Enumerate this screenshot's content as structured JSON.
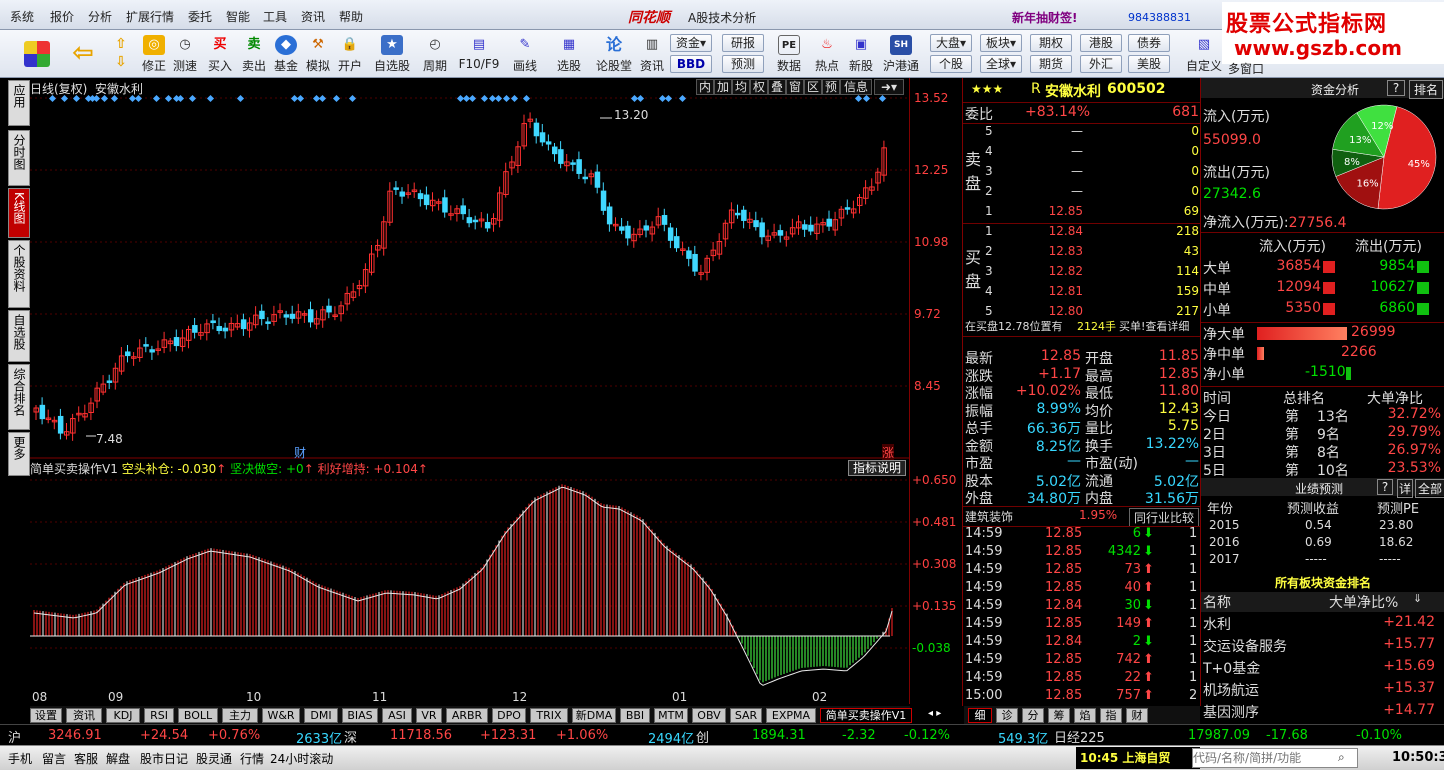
{
  "menu": {
    "items": [
      "系统",
      "报价",
      "分析",
      "扩展行情",
      "委托",
      "智能",
      "工具",
      "资讯",
      "帮助"
    ],
    "brand": "同花顺",
    "title": "A股技术分析",
    "promo": "新年抽财签!",
    "account": "984388831"
  },
  "watermark": {
    "line1": "股票公式指标网",
    "line2": "www.gszb.com"
  },
  "toolbar": {
    "buttons": [
      "修正",
      "测速",
      "买入",
      "卖出",
      "基金",
      "模拟",
      "开户",
      "自选股",
      "周期",
      "F10/F9",
      "画线",
      "选股",
      "论股堂",
      "资讯",
      "数据",
      "热点",
      "新股",
      "沪港通",
      "自定义",
      "多窗口"
    ],
    "small_top": [
      "资金",
      "研报",
      "大盘",
      "板块",
      "期权",
      "港股",
      "债券"
    ],
    "small_bottom": [
      "BBD",
      "预测",
      "个股",
      "全球",
      "期货",
      "外汇",
      "美股"
    ],
    "pe": "PE"
  },
  "sidetabs": [
    "应用",
    "分时图",
    "K线图",
    "个股资料",
    "自选股",
    "综合排名",
    "更多"
  ],
  "chart": {
    "title": "日线(复权)",
    "stock": "安徽水利",
    "tools": [
      "内",
      "加",
      "均",
      "权",
      "叠",
      "窗",
      "区",
      "预",
      "信息"
    ],
    "price_ticks": [
      "13.52",
      "12.25",
      "10.98",
      "9.72",
      "8.45"
    ],
    "high_mark": "13.20",
    "low_mark": "7.48",
    "mark_cai": "财",
    "mark_zhang": "涨",
    "ind_name": "简单买卖操作V1",
    "ind_v1": "空头补仓: -0.030",
    "ind_v2": "坚决做空: +0",
    "ind_v3": "利好增持: +0.104",
    "ind_help": "指标说明",
    "ind_ticks": [
      "+0.650",
      "+0.481",
      "+0.308",
      "+0.135",
      "-0.038"
    ],
    "dates": [
      "08",
      "09",
      "10",
      "11",
      "12",
      "01",
      "02"
    ]
  },
  "bottom_tabs": [
    "设置",
    "资讯",
    "KDJ",
    "RSI",
    "BOLL",
    "主力",
    "W&R",
    "DMI",
    "BIAS",
    "ASI",
    "VR",
    "ARBR",
    "DPO",
    "TRIX",
    "新DMA",
    "BBI",
    "MTM",
    "OBV",
    "SAR",
    "EXPMA",
    "简单买卖操作V1"
  ],
  "right_tabs": [
    "细",
    "诊",
    "分",
    "筹",
    "焰",
    "指",
    "财"
  ],
  "quote": {
    "stars": "★★★",
    "prefix": "R",
    "name": "安徽水利",
    "code": "600502",
    "weibi_label": "委比",
    "weibi": "+83.14%",
    "weicha": "681",
    "sell_label": "卖盘",
    "buy_label": "买盘",
    "sell": [
      {
        "n": "5",
        "p": "—",
        "v": "0"
      },
      {
        "n": "4",
        "p": "—",
        "v": "0"
      },
      {
        "n": "3",
        "p": "—",
        "v": "0"
      },
      {
        "n": "2",
        "p": "—",
        "v": "0"
      },
      {
        "n": "1",
        "p": "12.85",
        "v": "69"
      }
    ],
    "buy": [
      {
        "n": "1",
        "p": "12.84",
        "v": "218"
      },
      {
        "n": "2",
        "p": "12.83",
        "v": "43"
      },
      {
        "n": "3",
        "p": "12.82",
        "v": "114"
      },
      {
        "n": "4",
        "p": "12.81",
        "v": "159"
      },
      {
        "n": "5",
        "p": "12.80",
        "v": "217"
      }
    ],
    "notice": "在买盘12.78位置有",
    "notice_vol": "2124手",
    "notice_tail": "买单!查看详细",
    "stats": [
      [
        "最新",
        "12.85",
        "开盘",
        "11.85"
      ],
      [
        "涨跌",
        "+1.17",
        "最高",
        "12.85"
      ],
      [
        "涨幅",
        "+10.02%",
        "最低",
        "11.80"
      ],
      [
        "振幅",
        "8.99%",
        "均价",
        "12.43"
      ],
      [
        "总手",
        "66.36万",
        "量比",
        "5.75"
      ],
      [
        "金额",
        "8.25亿",
        "换手",
        "13.22%"
      ],
      [
        "市盈",
        "—",
        "市盈(动)",
        "—"
      ],
      [
        "股本",
        "5.02亿",
        "流通",
        "5.02亿"
      ],
      [
        "外盘",
        "34.80万",
        "内盘",
        "31.56万"
      ]
    ],
    "sector": "建筑装饰",
    "sector_chg": "1.95%",
    "sector_btn": "同行业比较",
    "ticks": [
      [
        "14:59",
        "12.85",
        "6",
        "1"
      ],
      [
        "14:59",
        "12.85",
        "4342",
        "1"
      ],
      [
        "14:59",
        "12.85",
        "73",
        "1"
      ],
      [
        "14:59",
        "12.85",
        "40",
        "1"
      ],
      [
        "14:59",
        "12.84",
        "30",
        "1"
      ],
      [
        "14:59",
        "12.85",
        "149",
        "1"
      ],
      [
        "14:59",
        "12.84",
        "2",
        "1"
      ],
      [
        "14:59",
        "12.85",
        "742",
        "1"
      ],
      [
        "14:59",
        "12.85",
        "22",
        "1"
      ],
      [
        "15:00",
        "12.85",
        "757",
        "2"
      ]
    ]
  },
  "funds": {
    "title": "资金分析",
    "rank_btn": "排名",
    "in_label": "流入(万元)",
    "in_val": "55099.0",
    "out_label": "流出(万元)",
    "out_val": "27342.6",
    "net_label": "净流入(万元):",
    "net_val": "27756.4",
    "pie": [
      {
        "label": "45%",
        "value": 45,
        "color": "#e02020"
      },
      {
        "label": "16%",
        "value": 16,
        "color": "#a01010"
      },
      {
        "label": "8%",
        "value": 8,
        "color": "#106010"
      },
      {
        "label": "13%",
        "value": 13,
        "color": "#20a020"
      },
      {
        "label": "12%",
        "value": 12,
        "color": "#40e040"
      }
    ],
    "col_in": "流入(万元)",
    "col_out": "流出(万元)",
    "rows": [
      {
        "name": "大单",
        "in": "36854",
        "out": "9854",
        "inf": 0.95,
        "outf": 0.26
      },
      {
        "name": "中单",
        "in": "12094",
        "out": "10627",
        "inf": 0.33,
        "outf": 0.29
      },
      {
        "name": "小单",
        "in": "5350",
        "out": "6860",
        "inf": 0.15,
        "outf": 0.19
      }
    ],
    "net": [
      {
        "name": "净大单",
        "val": "26999",
        "frac": 0.75
      },
      {
        "name": "净中单",
        "val": "2266",
        "frac": 0.06
      },
      {
        "name": "净小单",
        "val": "-1510",
        "frac": 0.04
      }
    ],
    "rank_head": [
      "时间",
      "总排名",
      "大单净比"
    ],
    "rank": [
      [
        "今日",
        "第",
        "13名",
        "32.72%"
      ],
      [
        "2日",
        "第",
        "9名",
        "29.79%"
      ],
      [
        "3日",
        "第",
        "8名",
        "26.97%"
      ],
      [
        "5日",
        "第",
        "10名",
        "23.53%"
      ]
    ],
    "forecast_title": "业绩预测",
    "forecast_q": "?",
    "forecast_detail": "详",
    "forecast_all": "全部",
    "forecast_head": [
      "年份",
      "预测收益",
      "预测PE"
    ],
    "forecast": [
      [
        "2015",
        "0.54",
        "23.80"
      ],
      [
        "2016",
        "0.69",
        "18.62"
      ],
      [
        "2017",
        "-----",
        "-----"
      ]
    ],
    "sector_title": "所有板块资金排名",
    "sector_head": [
      "名称",
      "大单净比%"
    ],
    "sectors": [
      [
        "水利",
        "+21.42"
      ],
      [
        "交运设备服务",
        "+15.77"
      ],
      [
        "T+0基金",
        "+15.69"
      ],
      [
        "机场航运",
        "+15.37"
      ],
      [
        "基因测序",
        "+14.77"
      ]
    ]
  },
  "status": {
    "sh_label": "沪",
    "sh": "3246.91",
    "sh_chg": "+24.54",
    "sh_pct": "+0.76%",
    "sh_amt": "2633亿",
    "sz_label": "深",
    "sz": "11718.56",
    "sz_chg": "+123.31",
    "sz_pct": "+1.06%",
    "sz_amt": "2494亿",
    "cy_label": "创",
    "cy": "1894.31",
    "cy_chg": "-2.32",
    "cy_pct": "-0.12%",
    "cy_amt": "549.3亿",
    "jp_label": "日经225",
    "jp": "17987.09",
    "jp_chg": "-17.68",
    "jp_pct": "-0.10%"
  },
  "status2": {
    "items": [
      "手机",
      "留言",
      "客服",
      "解盘",
      "股市日记",
      "股灵通",
      "行情",
      "24小时滚动"
    ],
    "news_time": "10:45",
    "news": "上海自贸",
    "search_placeholder": "代码/名称/简拼/功能",
    "clock": "10:50:30"
  }
}
